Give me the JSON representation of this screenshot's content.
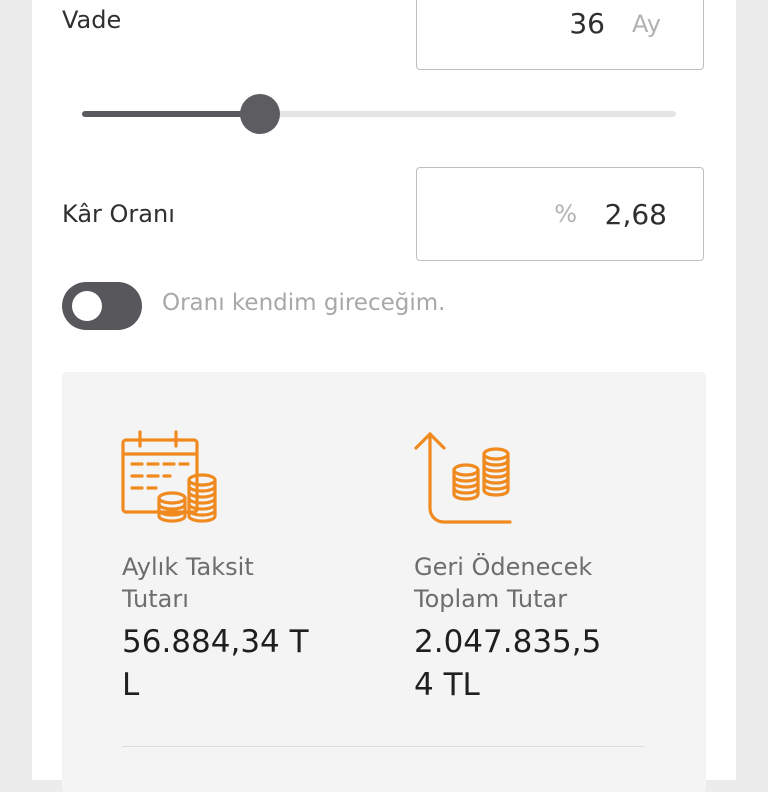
{
  "term": {
    "label": "Vade",
    "value": "36",
    "unit": "Ay",
    "slider_level": 0.3
  },
  "rate": {
    "label": "Kâr Oranı",
    "symbol": "%",
    "value": "2,68"
  },
  "toggle": {
    "label": "Oranı kendim gireceğim.",
    "on": false
  },
  "summary": {
    "monthly": {
      "label": "Aylık Taksit Tutarı",
      "value": "56.884,34 TL",
      "icon": "calendar-coins-icon"
    },
    "total": {
      "label": "Geri Ödenecek Toplam Tutar",
      "value": "2.047.835,54 TL",
      "icon": "growth-coins-icon"
    }
  },
  "colors": {
    "accent": "#F08A1E",
    "control": "#5A5A5E",
    "panel": "#F4F4F4"
  }
}
